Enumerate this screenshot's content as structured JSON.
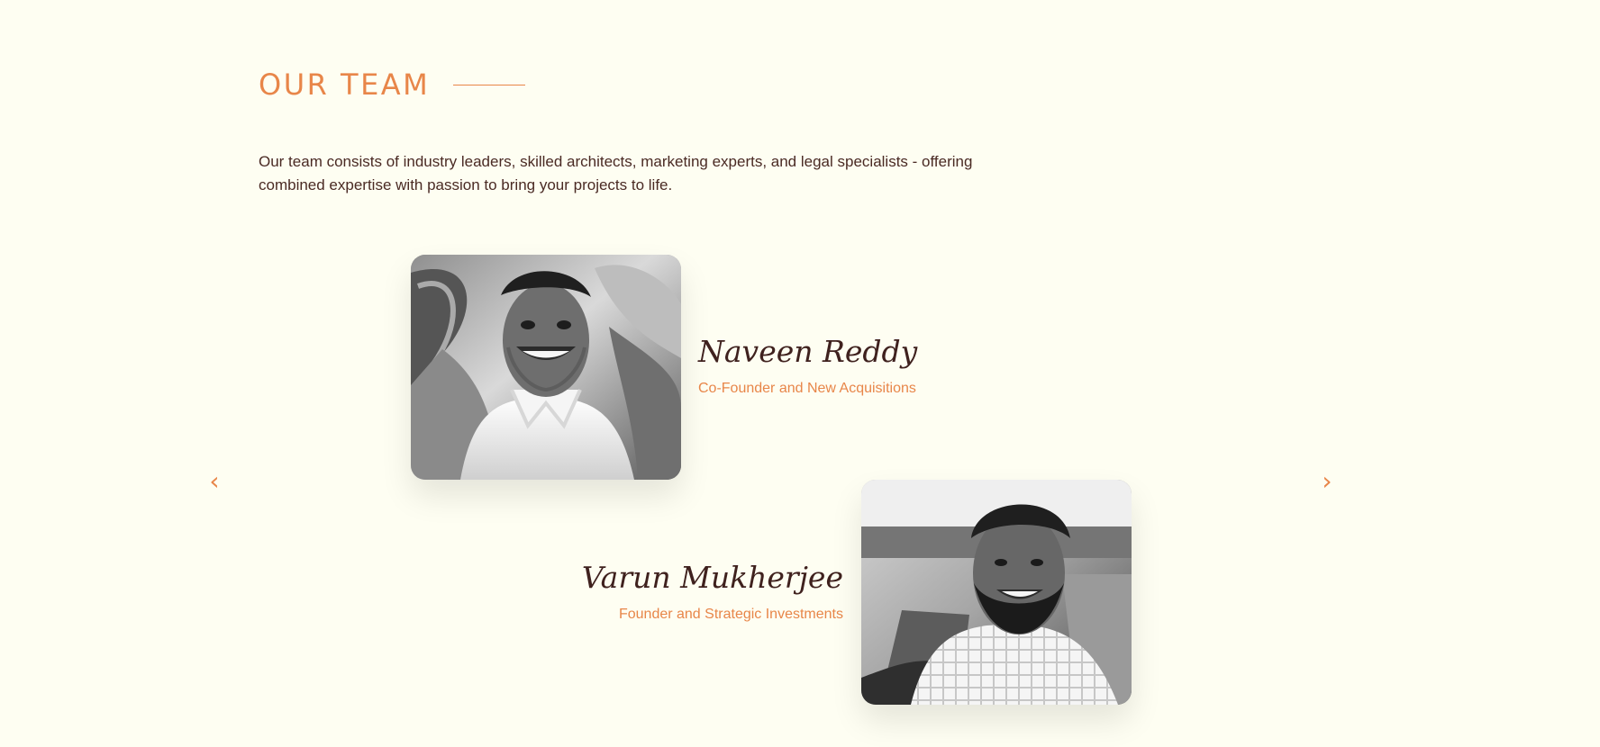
{
  "section": {
    "title": "OUR TEAM",
    "intro": "Our team consists of industry leaders, skilled architects, marketing experts, and legal specialists - offering combined expertise with passion to bring your projects to life."
  },
  "carousel": {
    "prev_icon": "‹",
    "next_icon": "›"
  },
  "team": [
    {
      "name": "Naveen Reddy",
      "role": "Co-Founder and New Acquisitions"
    },
    {
      "name": "Varun Mukherjee",
      "role": "Founder and Strategic Investments"
    }
  ],
  "colors": {
    "background": "#fefef2",
    "accent": "#e88649",
    "text": "#4a2a24"
  }
}
